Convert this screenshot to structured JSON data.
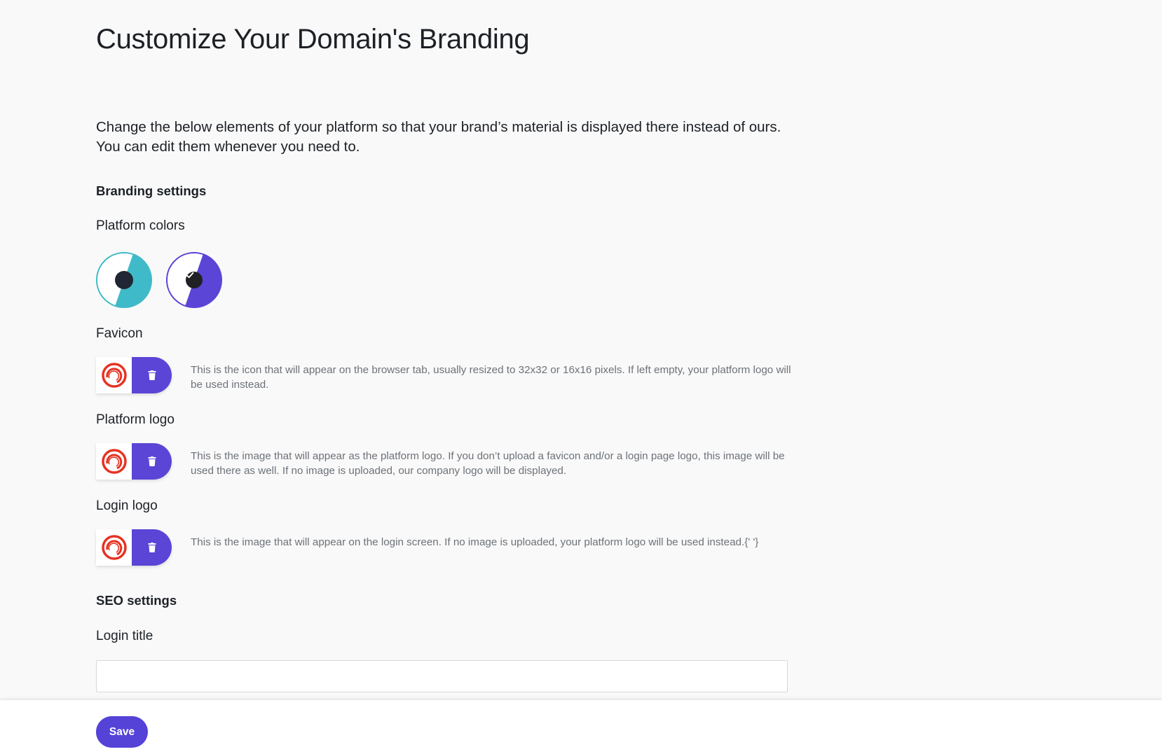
{
  "page": {
    "title": "Customize Your Domain's Branding",
    "intro": "Change the below elements of your platform so that your brand’s material is displayed there instead of ours. You can edit them whenever you need to."
  },
  "branding": {
    "heading": "Branding settings",
    "platform_colors": {
      "label": "Platform colors",
      "options": [
        {
          "name": "teal",
          "color": "#3fbac8",
          "selected": false
        },
        {
          "name": "purple",
          "color": "#5a45d6",
          "selected": true
        }
      ]
    },
    "favicon": {
      "label": "Favicon",
      "help": "This is the icon that will appear on the browser tab, usually resized to 32x32 or 16x16 pixels. If left empty, your platform logo will be used instead."
    },
    "platform_logo": {
      "label": "Platform logo",
      "help": "This is the image that will appear as the platform logo. If you don’t upload a favicon and/or a login page logo, this image will be used there as well. If no image is uploaded, our company logo will be displayed."
    },
    "login_logo": {
      "label": "Login logo",
      "help": "This is the image that will appear on the login screen. If no image is uploaded, your platform logo will be used instead.{' '}"
    }
  },
  "seo": {
    "heading": "SEO settings",
    "login_title": {
      "label": "Login title",
      "value": ""
    }
  },
  "footer": {
    "save_label": "Save"
  },
  "icons": {
    "logo_preview": "red-swirl-logo-icon",
    "delete": "trash-icon",
    "selected": "check-icon"
  },
  "colors": {
    "accent": "#5a45d6",
    "logo_red": "#e63223"
  }
}
